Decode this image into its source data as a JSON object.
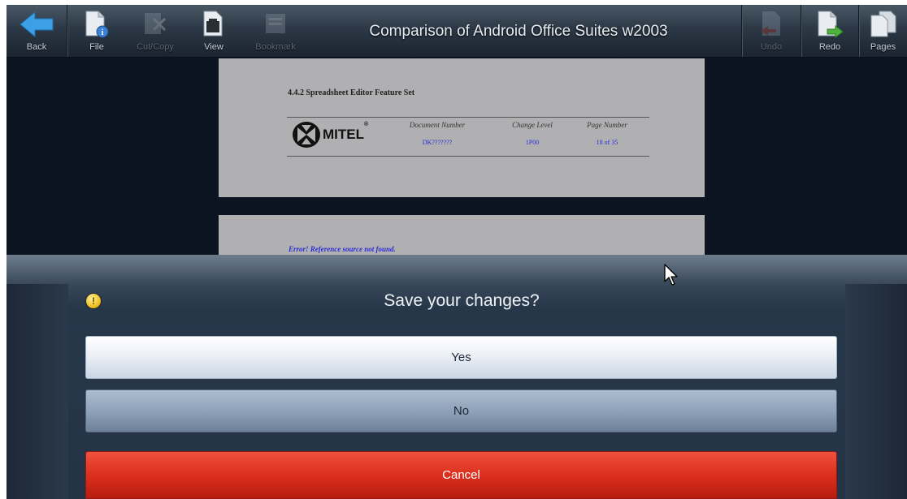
{
  "toolbar": {
    "title": "Comparison of Android Office Suites w2003",
    "buttons": [
      {
        "label": "Back",
        "icon": "back-arrow-icon",
        "enabled": true
      },
      {
        "label": "File",
        "icon": "file-info-icon",
        "enabled": true
      },
      {
        "label": "Cut/Copy",
        "icon": "cut-copy-icon",
        "enabled": false
      },
      {
        "label": "View",
        "icon": "view-icon",
        "enabled": true
      },
      {
        "label": "Bookmark",
        "icon": "bookmark-icon",
        "enabled": false
      },
      {
        "label": "Undo",
        "icon": "undo-icon",
        "enabled": false
      },
      {
        "label": "Redo",
        "icon": "redo-icon",
        "enabled": true
      },
      {
        "label": "Pages",
        "icon": "pages-icon",
        "enabled": true
      }
    ]
  },
  "document": {
    "section_heading": "4.4.2   Spreadsheet Editor Feature Set",
    "logo_text": "MITEL",
    "logo_mark": "®",
    "columns": [
      {
        "header": "Document Number",
        "value": "DK???????"
      },
      {
        "header": "Change Level",
        "value": "1P00"
      },
      {
        "header": "Page Number",
        "value": "18 of 35"
      }
    ],
    "error_text": "Error! Reference source not found."
  },
  "dialog": {
    "title": "Save your changes?",
    "yes_label": "Yes",
    "no_label": "No",
    "cancel_label": "Cancel",
    "warning_icon": "warning-icon"
  },
  "colors": {
    "accent_blue": "#3ba0e6",
    "cancel_red": "#dc2f1d",
    "link_blue": "#2a2ad6"
  }
}
